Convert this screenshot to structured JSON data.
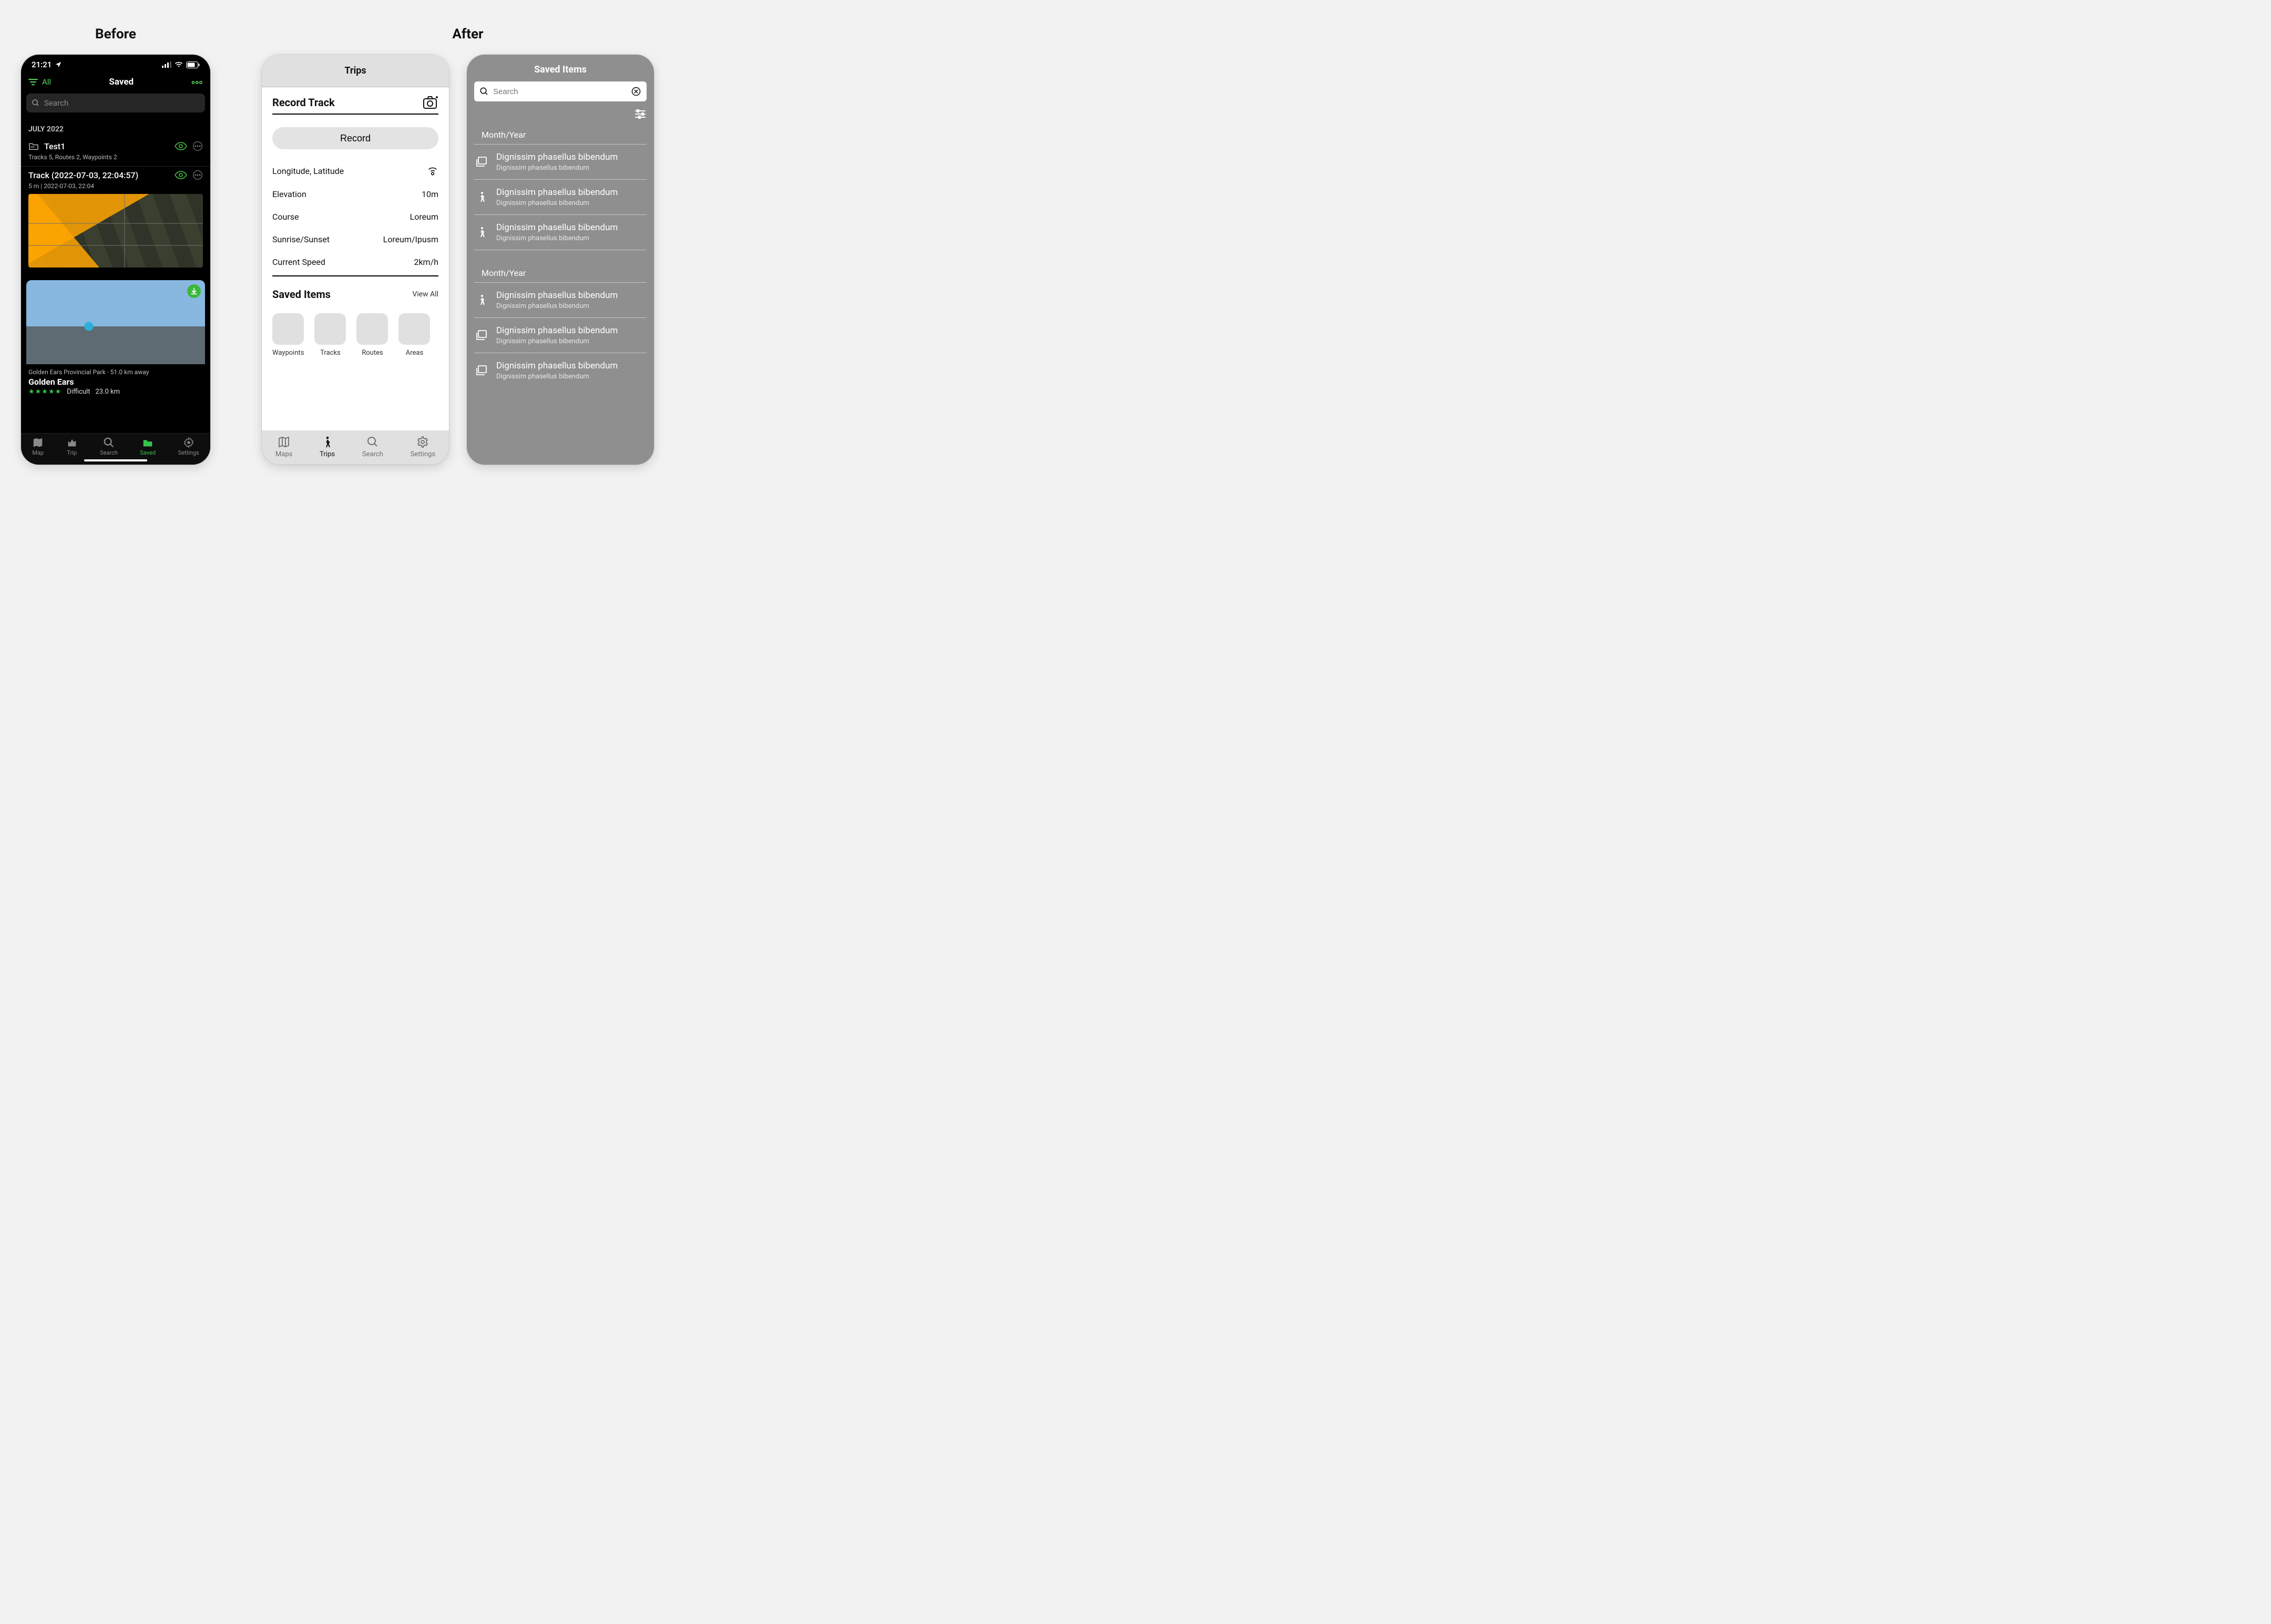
{
  "labels": {
    "before": "Before",
    "after": "After"
  },
  "before": {
    "status": {
      "time": "21:21"
    },
    "filter_label": "All",
    "screen_title": "Saved",
    "more_label": "ooo",
    "search_placeholder": "Search",
    "month_header": "JULY 2022",
    "item1": {
      "title": "Test1",
      "sub": "Tracks 5, Routes 2, Waypoints 2"
    },
    "item2": {
      "title": "Track (2022-07-03, 22:04:57)",
      "sub": "5 m | 2022-07-03, 22:04"
    },
    "trail": {
      "meta": "Golden Ears Provincial Park · 51.0 km away",
      "name": "Golden Ears",
      "difficulty": "Difficult",
      "distance": "23.0 km",
      "stars": "★★★★★"
    },
    "nav": {
      "map": "Map",
      "trip": "Trip",
      "search": "Search",
      "saved": "Saved",
      "settings": "Settings"
    }
  },
  "after": {
    "trips": {
      "header": "Trips",
      "section_title": "Record Track",
      "record_btn": "Record",
      "rows": {
        "loc_label": "Longitude, Latitude",
        "elev_label": "Elevation",
        "elev_value": "10m",
        "course_label": "Course",
        "course_value": "Loreum",
        "sun_label": "Sunrise/Sunset",
        "sun_value": "Loreum/Ipusm",
        "speed_label": "Current Speed",
        "speed_value": "2km/h"
      },
      "saved_items_header": "Saved Items",
      "view_all": "View All",
      "tiles": {
        "waypoints": "Waypoints",
        "tracks": "Tracks",
        "routes": "Routes",
        "areas": "Areas"
      },
      "nav": {
        "maps": "Maps",
        "trips": "Trips",
        "search": "Search",
        "settings": "Settings"
      }
    },
    "saved": {
      "header": "Saved Items",
      "search_placeholder": "Search",
      "group_header": "Month/Year",
      "item_title": "Dignissim phasellus bibendum",
      "item_sub": "Dignissim phasellus bibendum"
    }
  }
}
